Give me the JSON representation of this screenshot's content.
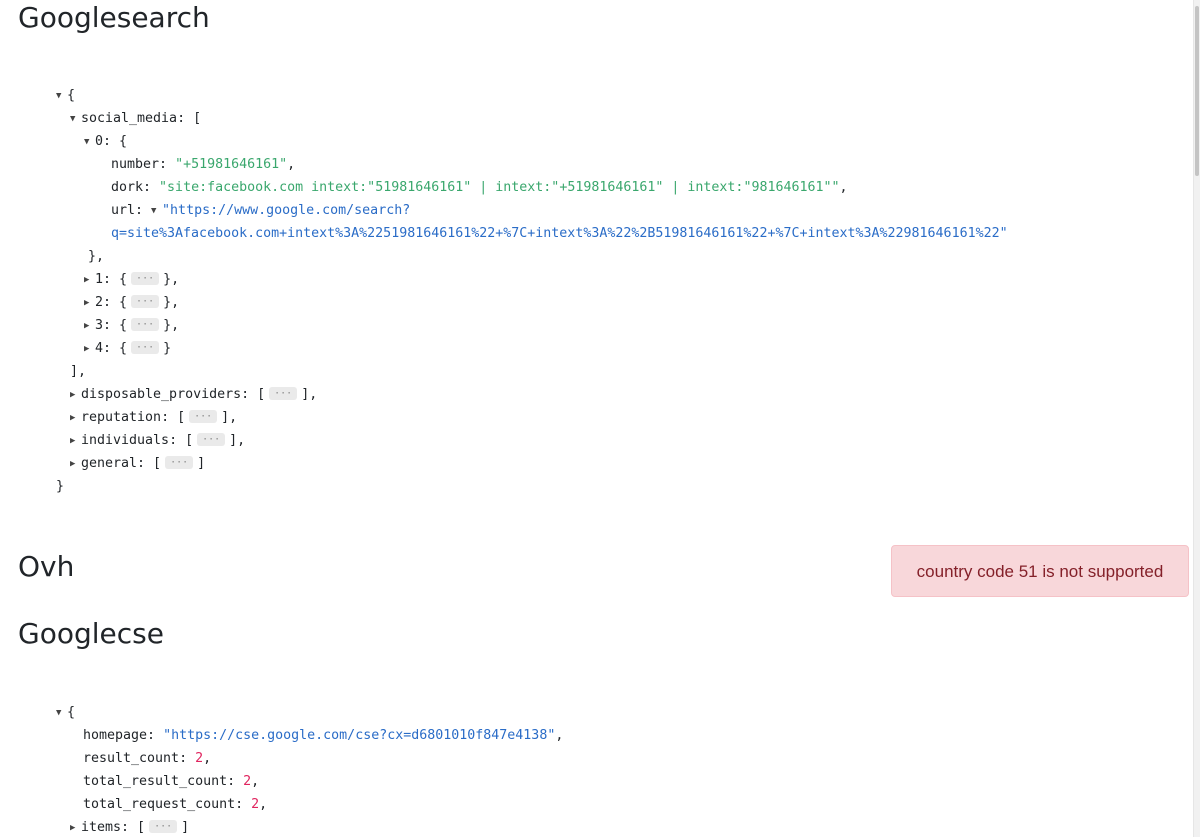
{
  "sections": {
    "googlesearch": {
      "title": "Googlesearch",
      "open_brace": "{",
      "close_brace": "}",
      "social_media": {
        "key": "social_media",
        "item0": {
          "index": "0",
          "number_key": "number",
          "number_value": "\"+51981646161\"",
          "dork_key": "dork",
          "dork_value": "\"site:facebook.com intext:\"51981646161\" | intext:\"+51981646161\" | intext:\"981646161\"\"",
          "url_key": "url",
          "url_value_line1": "\"https://www.google.com/search?",
          "url_value_line2": "q=site%3Afacebook.com+intext%3A%2251981646161%22+%7C+intext%3A%22%2B51981646161%22+%7C+intext%3A%22981646161%22\""
        },
        "collapsed_items": [
          "1",
          "2",
          "3",
          "4"
        ]
      },
      "collapsed_keys": [
        "disposable_providers",
        "reputation",
        "individuals",
        "general"
      ]
    },
    "ovh": {
      "title": "Ovh",
      "error": "country code 51 is not supported"
    },
    "googlecse": {
      "title": "Googlecse",
      "open_brace": "{",
      "homepage_key": "homepage",
      "homepage_value": "\"https://cse.google.com/cse?cx=d6801010f847e4138\"",
      "result_count_key": "result_count",
      "result_count_value": "2",
      "total_result_count_key": "total_result_count",
      "total_result_count_value": "2",
      "total_request_count_key": "total_request_count",
      "total_request_count_value": "2",
      "items_key": "items"
    }
  },
  "ellipsis": "···",
  "icons": {
    "expanded": "triangle-down-icon",
    "collapsed": "triangle-right-icon"
  },
  "colors": {
    "string": "#3aa76d",
    "url": "#2a6cc7",
    "number": "#e0245e",
    "alert_bg": "#f8d7da",
    "alert_text": "#842029"
  }
}
